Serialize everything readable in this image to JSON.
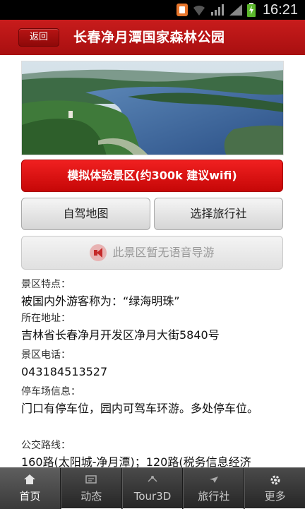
{
  "status_bar": {
    "time": "16:21"
  },
  "header": {
    "back_label": "返回",
    "title": "长春净月潭国家森林公园"
  },
  "actions": {
    "virtual_tour_label": "模拟体验景区(约300k 建议wifi)",
    "self_drive_map_label": "自驾地图",
    "choose_agency_label": "选择旅行社",
    "audio_guide_label": "此景区暂无语音导游"
  },
  "info": [
    {
      "label": "景区特点：",
      "value": "被国内外游客称为：“绿海明珠”"
    },
    {
      "label": "所在地址：",
      "value": "吉林省长春净月开发区净月大街5840号"
    },
    {
      "label": "景区电话：",
      "value": "043184513527"
    },
    {
      "label": "停车场信息：",
      "value": "门口有停车位，园内可驾车环游。多处停车位。"
    },
    {
      "label": "公交路线：",
      "value": "160路(太阳城-净月潭)；120路(税务信息经济"
    }
  ],
  "tabs": [
    {
      "label": "首页",
      "icon": "home-icon"
    },
    {
      "label": "动态",
      "icon": "news-icon"
    },
    {
      "label": "Tour3D",
      "icon": "tour3d-icon"
    },
    {
      "label": "旅行社",
      "icon": "agency-icon"
    },
    {
      "label": "更多",
      "icon": "gear-icon"
    }
  ],
  "colors": {
    "brand_red": "#c81c1c",
    "tab_bar": "#333333"
  }
}
